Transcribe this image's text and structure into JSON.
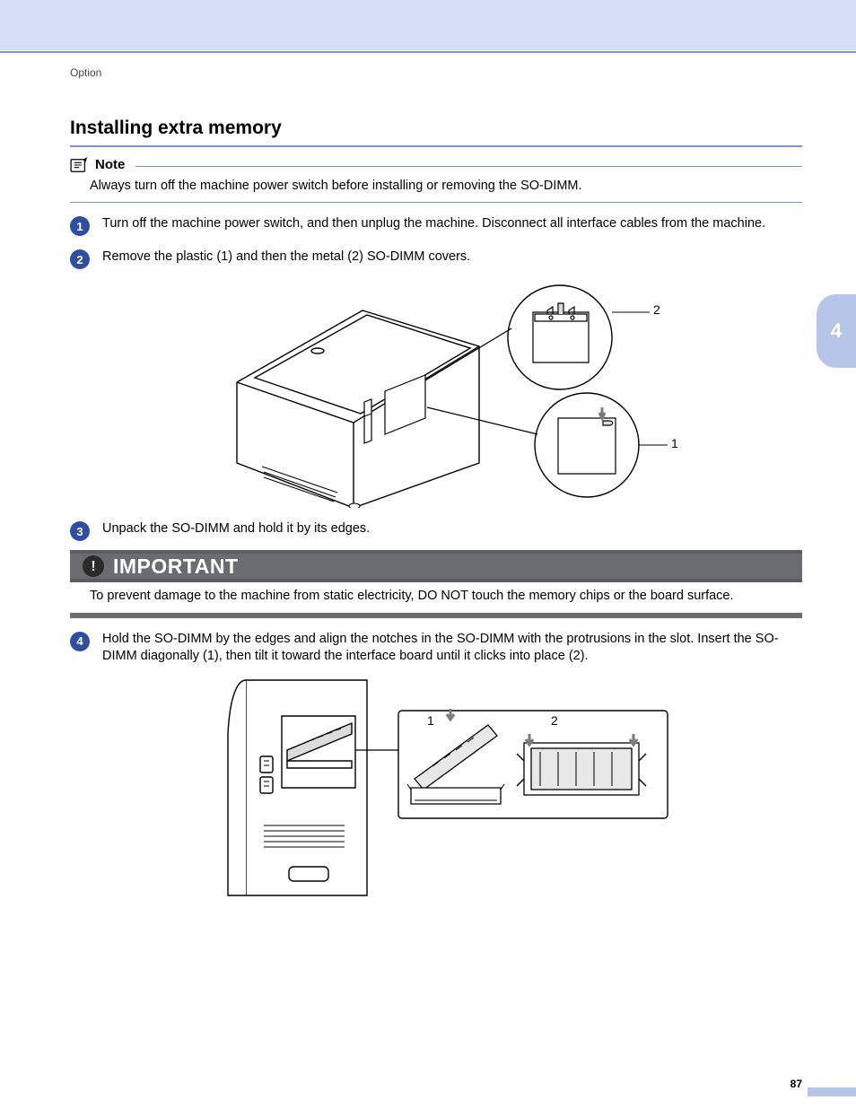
{
  "header": {
    "breadcrumb": "Option",
    "chapter_tab": "4",
    "page_number": "87"
  },
  "section": {
    "title": "Installing extra memory"
  },
  "note": {
    "label": "Note",
    "text": "Always turn off the machine power switch before installing or removing the SO-DIMM."
  },
  "steps": [
    {
      "num": "1",
      "text": "Turn off the machine power switch, and then unplug the machine. Disconnect all interface cables from the machine."
    },
    {
      "num": "2",
      "text": "Remove the plastic (1) and then the metal (2) SO-DIMM covers."
    },
    {
      "num": "3",
      "text": "Unpack the SO-DIMM and hold it by its edges."
    },
    {
      "num": "4",
      "text": "Hold the SO-DIMM by the edges and align the notches in the SO-DIMM with the protrusions in the slot. Insert the SO-DIMM diagonally (1), then tilt it toward the interface board until it clicks into place (2)."
    }
  ],
  "important": {
    "label": "IMPORTANT",
    "text": "To prevent damage to the machine from static electricity, DO NOT touch the memory chips or the board surface."
  },
  "figure1": {
    "callout_1": "1",
    "callout_2": "2"
  },
  "figure2": {
    "callout_1": "1",
    "callout_2": "2"
  }
}
